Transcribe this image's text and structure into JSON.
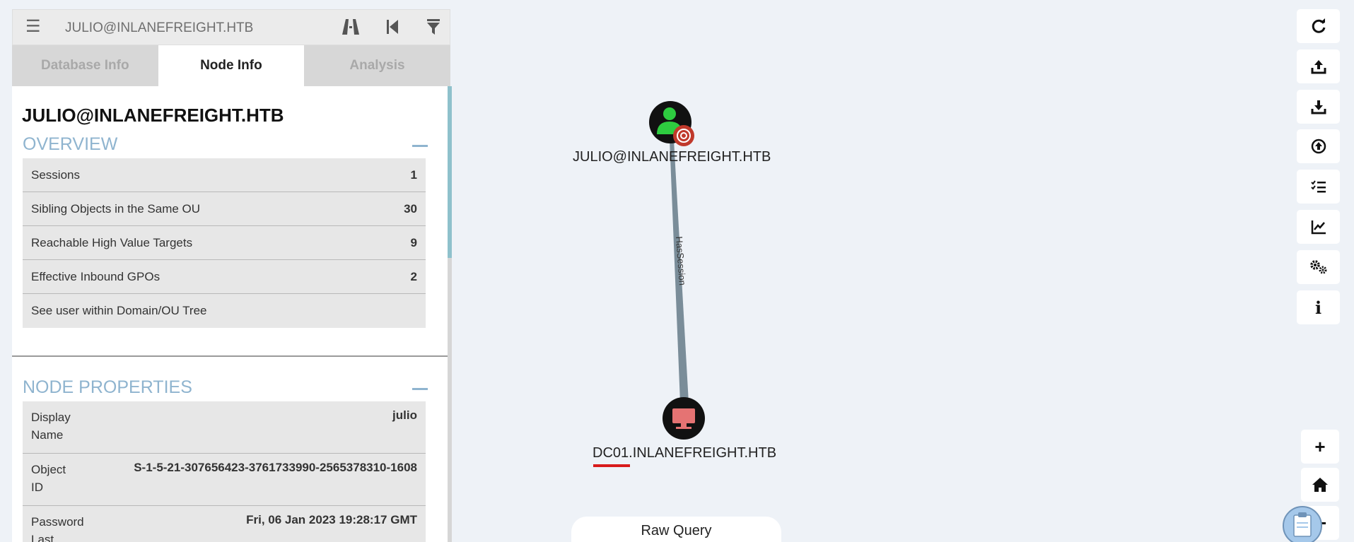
{
  "search": {
    "value": "JULIO@INLANEFREIGHT.HTB"
  },
  "tabs": [
    {
      "label": "Database Info"
    },
    {
      "label": "Node Info"
    },
    {
      "label": "Analysis"
    }
  ],
  "node": {
    "title": "JULIO@INLANEFREIGHT.HTB"
  },
  "overview": {
    "title": "OVERVIEW",
    "rows": [
      {
        "label": "Sessions",
        "value": "1"
      },
      {
        "label": "Sibling Objects in the Same OU",
        "value": "30"
      },
      {
        "label": "Reachable High Value Targets",
        "value": "9"
      },
      {
        "label": "Effective Inbound GPOs",
        "value": "2"
      },
      {
        "label": "See user within Domain/OU Tree",
        "value": ""
      }
    ]
  },
  "node_properties": {
    "title": "NODE PROPERTIES",
    "rows": [
      {
        "label": "Display Name",
        "value": "julio"
      },
      {
        "label": "Object ID",
        "value": "S-1-5-21-307656423-3761733990-2565378310-1608"
      },
      {
        "label": "Password Last",
        "value": "Fri, 06 Jan 2023 19:28:17 GMT"
      }
    ]
  },
  "graph": {
    "user_node": "JULIO@INLANEFREIGHT.HTB",
    "computer_node": "DC01.INLANEFREIGHT.HTB",
    "edge_label": "HasSession"
  },
  "raw_query": {
    "label": "Raw Query"
  },
  "toolbar": {
    "icons": [
      "refresh-icon",
      "upload-icon",
      "download-icon",
      "import-icon",
      "query-list-icon",
      "chart-icon",
      "settings-icon",
      "info-icon"
    ],
    "info_glyph": "i"
  },
  "zoom": {
    "zoom_in_glyph": "+"
  },
  "colors": {
    "accent": "#8fb4cf",
    "user_node": "#2ecc40",
    "computer_node": "#e57373",
    "highvalue_badge": "#c0392b"
  }
}
